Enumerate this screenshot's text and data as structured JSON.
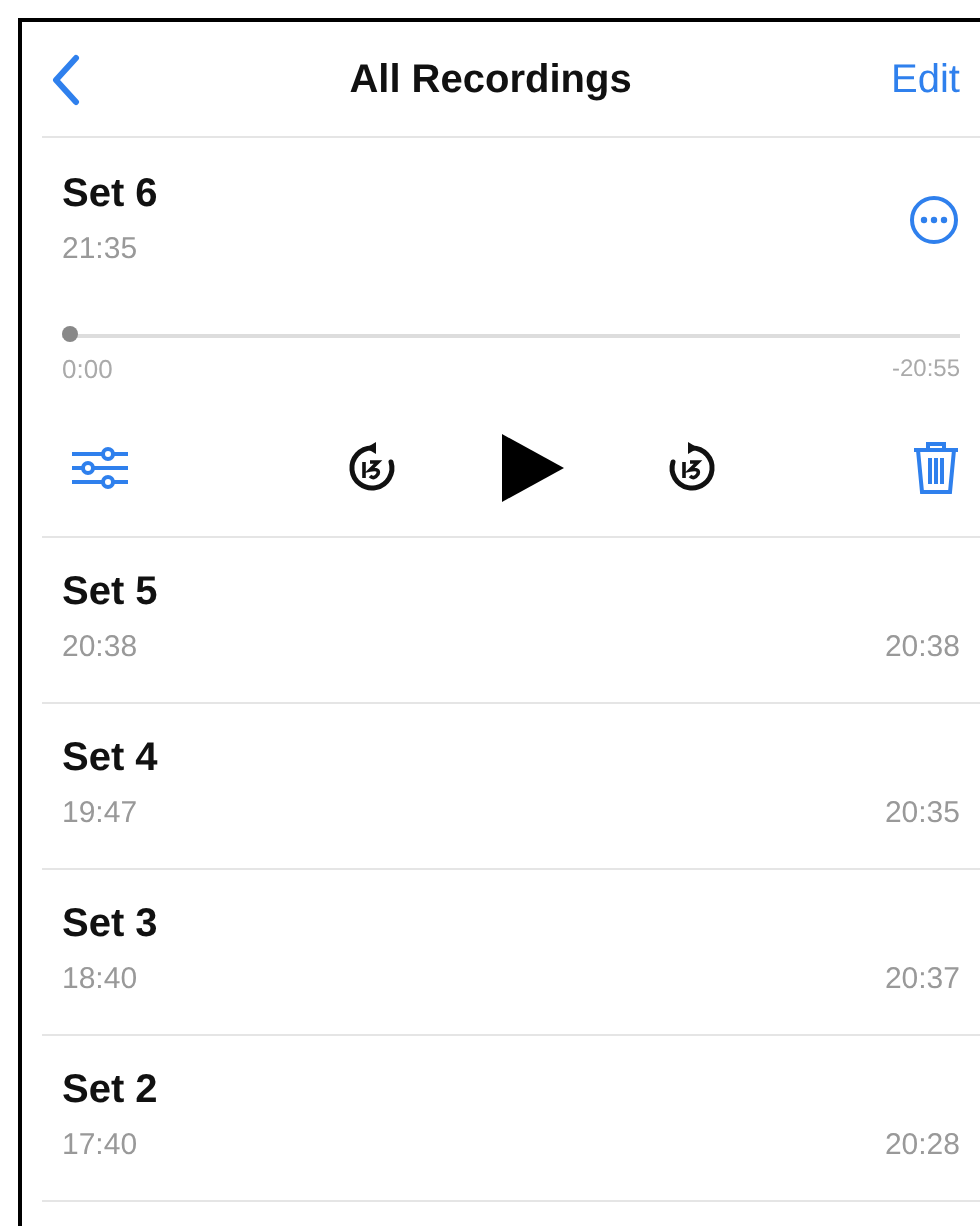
{
  "nav": {
    "title": "All Recordings",
    "edit": "Edit"
  },
  "current": {
    "title": "Set 6",
    "time": "21:35",
    "level": 0,
    "elapsed": "0:00",
    "remaining": "-20:55"
  },
  "recordings": [
    {
      "title": "Set 5",
      "time": "20:38",
      "duration": "20:38"
    },
    {
      "title": "Set 4",
      "time": "19:47",
      "duration": "20:35"
    },
    {
      "title": "Set 3",
      "time": "18:40",
      "duration": "20:37"
    },
    {
      "title": "Set 2",
      "time": "17:40",
      "duration": "20:28"
    }
  ]
}
